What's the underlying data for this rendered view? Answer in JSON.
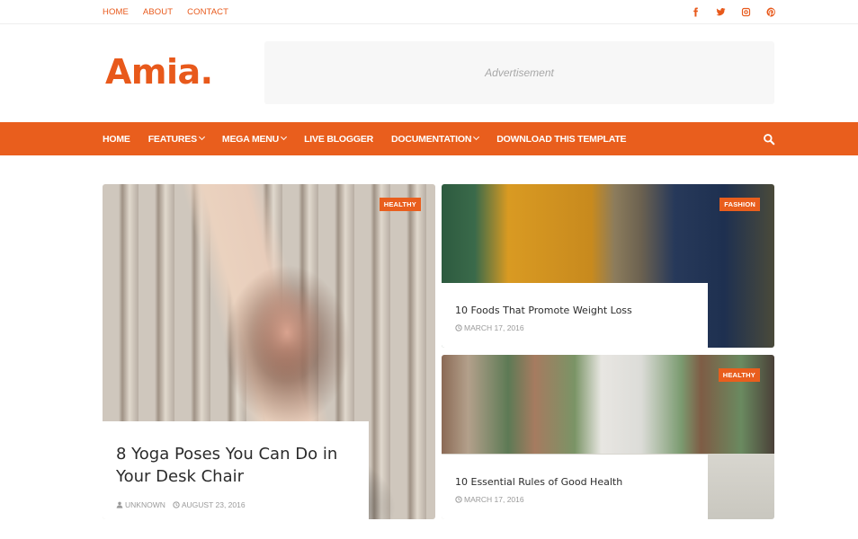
{
  "topbar": {
    "links": [
      "HOME",
      "ABOUT",
      "CONTACT"
    ],
    "social": [
      "facebook-icon",
      "twitter-icon",
      "instagram-icon",
      "pinterest-icon"
    ]
  },
  "header": {
    "logo": "Amia.",
    "ad_label": "Advertisement"
  },
  "nav": {
    "items": [
      {
        "label": "HOME",
        "dropdown": false
      },
      {
        "label": "FEATURES",
        "dropdown": true
      },
      {
        "label": "MEGA MENU",
        "dropdown": true
      },
      {
        "label": "LIVE BLOGGER",
        "dropdown": false
      },
      {
        "label": "DOCUMENTATION",
        "dropdown": true
      },
      {
        "label": "DOWNLOAD THIS TEMPLATE",
        "dropdown": false
      }
    ],
    "search_icon": "search-icon"
  },
  "colors": {
    "accent": "#e95e1d"
  },
  "posts": [
    {
      "category": "HEALTHY",
      "title": "8 Yoga Poses You Can Do in Your Desk Chair",
      "author": "UNKNOWN",
      "date": "AUGUST 23, 2016"
    },
    {
      "category": "FASHION",
      "title": "10 Foods That Promote Weight Loss",
      "date": "MARCH 17, 2016"
    },
    {
      "category": "HEALTHY",
      "title": "10 Essential Rules of Good Health",
      "date": "MARCH 17, 2016"
    }
  ]
}
